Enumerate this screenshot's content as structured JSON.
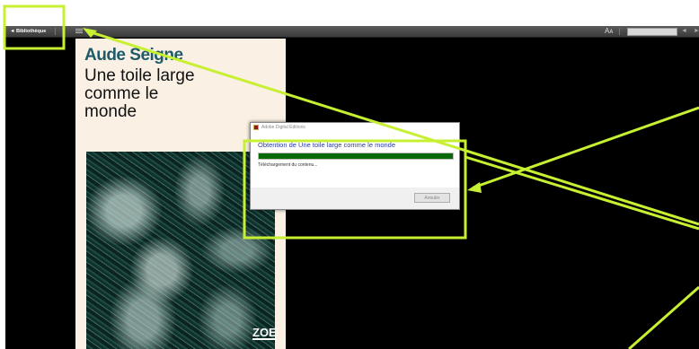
{
  "toolbar": {
    "library_label": "◄ Bibliothèque",
    "menu_icon": "hamburger-menu-icon",
    "font_size_glyph": "Aᴀ",
    "search_placeholder": "",
    "prev_glyph": "◄",
    "next_glyph": "►"
  },
  "book": {
    "author": "Aude Seigne",
    "title": "Une toile large comme le monde",
    "publisher": "ZOE"
  },
  "dialog": {
    "window_title": "Adobe Digital Editions",
    "heading": "Obtention de Une toile large comme le monde",
    "progress_fraction": 1.0,
    "status": "Téléchargement du contenu...",
    "cancel_label": "Annuler"
  },
  "colors": {
    "annotation": "#c8f032",
    "progress": "#0a6a0a",
    "author": "#1e5a6a"
  }
}
